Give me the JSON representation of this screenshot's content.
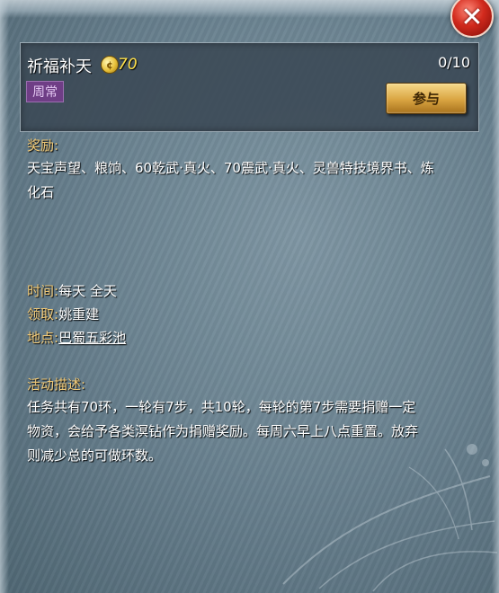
{
  "close_button": {
    "label": "✕"
  },
  "activity": {
    "name": "祈福补天",
    "points": "70",
    "progress": "0/10",
    "tag": "周常",
    "join_label": "参与"
  },
  "rewards": {
    "label": "奖励:",
    "text": "天宝声望、粮饷、60乾武·真火、70震武·真火、灵兽特技境界书、炼化石"
  },
  "info": {
    "time_label": "时间:",
    "time_value": "每天 全天",
    "npc_label": "领取:",
    "npc_value": "姚重建",
    "place_label": "地点:",
    "place_value": "巴蜀五彩池"
  },
  "description": {
    "label": "活动描述:",
    "text": "任务共有70环，一轮有7步，共10轮，每轮的第7步需要捐赠一定物资，会给予各类溟钻作为捐赠奖励。每周六早上八点重置。放弃则减少总的可做环数。"
  },
  "colors": {
    "label_gold": "#f0c977",
    "points_yellow": "#ffe14a",
    "tag_purple": "#6f3e86",
    "button_gold": "#d9a441",
    "close_red": "#d22a1d"
  },
  "icons": {
    "close": "close-icon",
    "coin": "coin-icon"
  }
}
